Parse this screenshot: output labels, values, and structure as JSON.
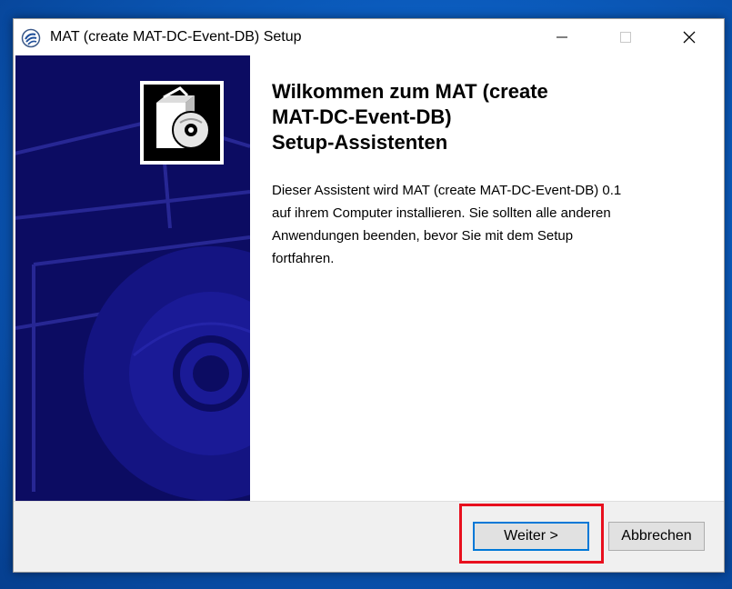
{
  "window": {
    "title": "MAT (create MAT-DC-Event-DB) Setup",
    "app_icon": "setup-app-icon",
    "controls": {
      "minimize_icon": "minimize-icon",
      "maximize_icon": "maximize-icon",
      "close_icon": "close-icon"
    }
  },
  "side_panel": {
    "logo_icon": "install-package-cd-icon",
    "background_color": "#0c0c62"
  },
  "content": {
    "heading_line1": "Wilkommen zum MAT (create",
    "heading_line2": "MAT-DC-Event-DB)",
    "heading_line3": "Setup-Assistenten",
    "desc_line1": "Dieser Assistent wird MAT (create MAT-DC-Event-DB) 0.1",
    "desc_line2": "auf ihrem Computer installieren. Sie sollten alle anderen",
    "desc_line3": "Anwendungen beenden, bevor Sie mit dem Setup",
    "desc_line4": "fortfahren."
  },
  "buttons": {
    "next_label": "Weiter >",
    "cancel_label": "Abbrechen"
  },
  "highlight": {
    "color": "#e8101e"
  }
}
